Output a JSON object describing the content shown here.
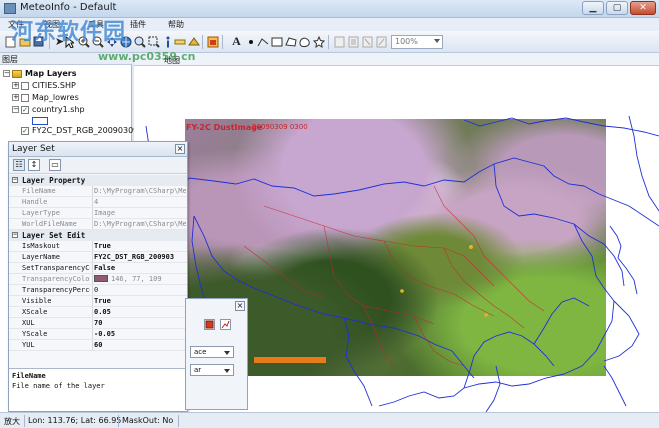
{
  "window": {
    "title": "MeteoInfo - Default",
    "min": "▁",
    "max": "▢",
    "close": "✕"
  },
  "menu": [
    "文件",
    "视图",
    "工具",
    "插件",
    "帮助"
  ],
  "toolbar": {
    "zoom_value": "100%"
  },
  "legend": {
    "tab": "图层",
    "root": "Map Layers",
    "layers": [
      {
        "name": "CITIES.SHP",
        "checked": false
      },
      {
        "name": "Map_lowres",
        "checked": false
      },
      {
        "name": "country1.shp",
        "checked": true
      },
      {
        "name": "FY2C_DST_RGB_20090309",
        "checked": true
      }
    ]
  },
  "mapview": {
    "tab": "地图"
  },
  "image": {
    "title": "FY-2C DustImage",
    "subtitle": "20090309 0300"
  },
  "layer_set": {
    "title": "Layer Set",
    "categories": [
      "Layer Property",
      "Layer Set Edit"
    ],
    "rows_property": [
      {
        "key": "FileName",
        "value": "D:\\MyProgram\\CSharp\\Me"
      },
      {
        "key": "Handle",
        "value": "4"
      },
      {
        "key": "LayerType",
        "value": "Image"
      },
      {
        "key": "WorldFileName",
        "value": "D:\\MyProgram\\CSharp\\Me"
      }
    ],
    "rows_edit": [
      {
        "key": "IsMaskout",
        "value": "True"
      },
      {
        "key": "LayerName",
        "value": "FY2C_DST_RGB_200903"
      },
      {
        "key": "SetTransparencyCo",
        "value": "False"
      },
      {
        "key": "TransparencyColor",
        "value": "146, 77, 109"
      },
      {
        "key": "TransparencyPerce",
        "value": "0"
      },
      {
        "key": "Visible",
        "value": "True"
      },
      {
        "key": "XScale",
        "value": "0.05"
      },
      {
        "key": "XUL",
        "value": "70"
      },
      {
        "key": "YScale",
        "value": "-0.05"
      },
      {
        "key": "YUL",
        "value": "60"
      }
    ],
    "desc_title": "FileName",
    "desc_text": "File name of the layer"
  },
  "dialog2": {
    "select1": "ace",
    "select2": "ar"
  },
  "status": {
    "mode": "放大",
    "coords": "Lon: 113.76; Lat: 66.95",
    "maskout": "MaskOut: No"
  },
  "watermark": {
    "text": "河东软件园",
    "url": "www.pc0359.cn"
  },
  "colors": {
    "map_line": "#1f2fd8",
    "border_red": "#c8242c",
    "transparency_chip": "#925b6d"
  }
}
